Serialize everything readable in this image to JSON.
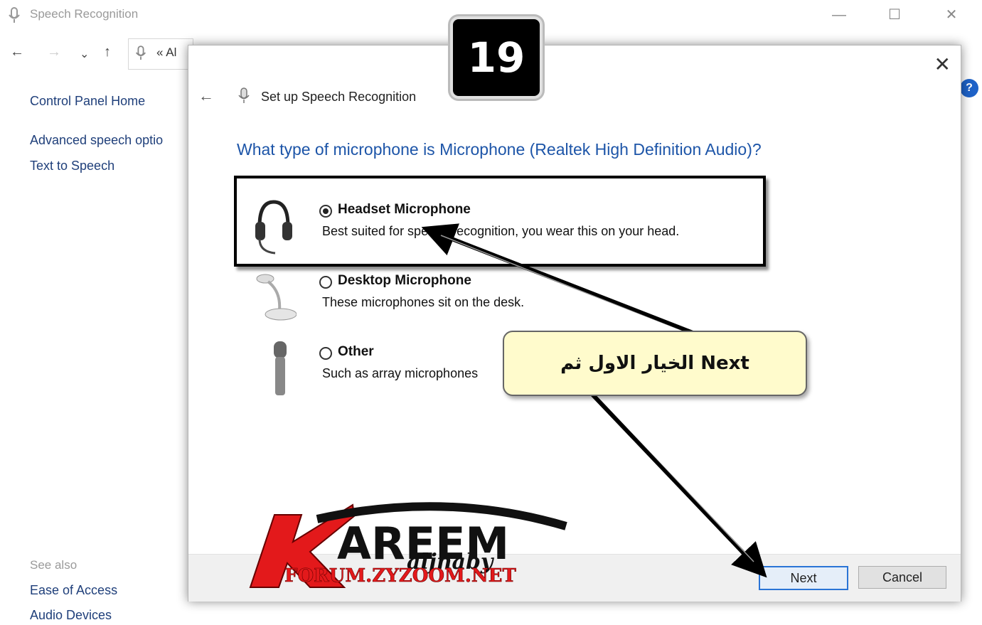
{
  "window": {
    "title": "Speech Recognition",
    "minimize": "—",
    "maximize": "☐",
    "close": "✕"
  },
  "nav": {
    "back": "←",
    "forward": "→",
    "recent": "⌄",
    "up": "↑",
    "address": "« Al"
  },
  "sidebar": {
    "items": [
      {
        "label": "Control Panel Home"
      },
      {
        "label": "Advanced speech optio"
      },
      {
        "label": "Text to Speech"
      }
    ],
    "see_also_label": "See also",
    "see_also": [
      {
        "label": "Ease of Access"
      },
      {
        "label": "Audio Devices"
      }
    ]
  },
  "help": "?",
  "dialog": {
    "close": "✕",
    "back": "←",
    "title": "Set up Speech Recognition",
    "question": "What type of microphone is Microphone (Realtek High Definition Audio)?",
    "options": [
      {
        "title": "Headset Microphone",
        "description": "Best suited for speech recognition, you wear this on your head.",
        "selected": true
      },
      {
        "title": "Desktop Microphone",
        "description": "These microphones sit on the desk.",
        "selected": false
      },
      {
        "title": "Other",
        "description": "Such as array microphones",
        "selected": false
      }
    ],
    "next_label": "Next",
    "cancel_label": "Cancel"
  },
  "overlay": {
    "step_number": "19",
    "callout": "الخيار الاول ثم  Next",
    "logo_main": "AREEM",
    "logo_initial": "K",
    "logo_script": "aljnaby",
    "logo_url": "FORUM.ZYZOOM.NET"
  },
  "colors": {
    "link": "#1f3f7a",
    "question": "#1d55a8",
    "accent": "#2a74d6",
    "callout_bg": "#fffbcc",
    "logo_red": "#e3191b"
  }
}
